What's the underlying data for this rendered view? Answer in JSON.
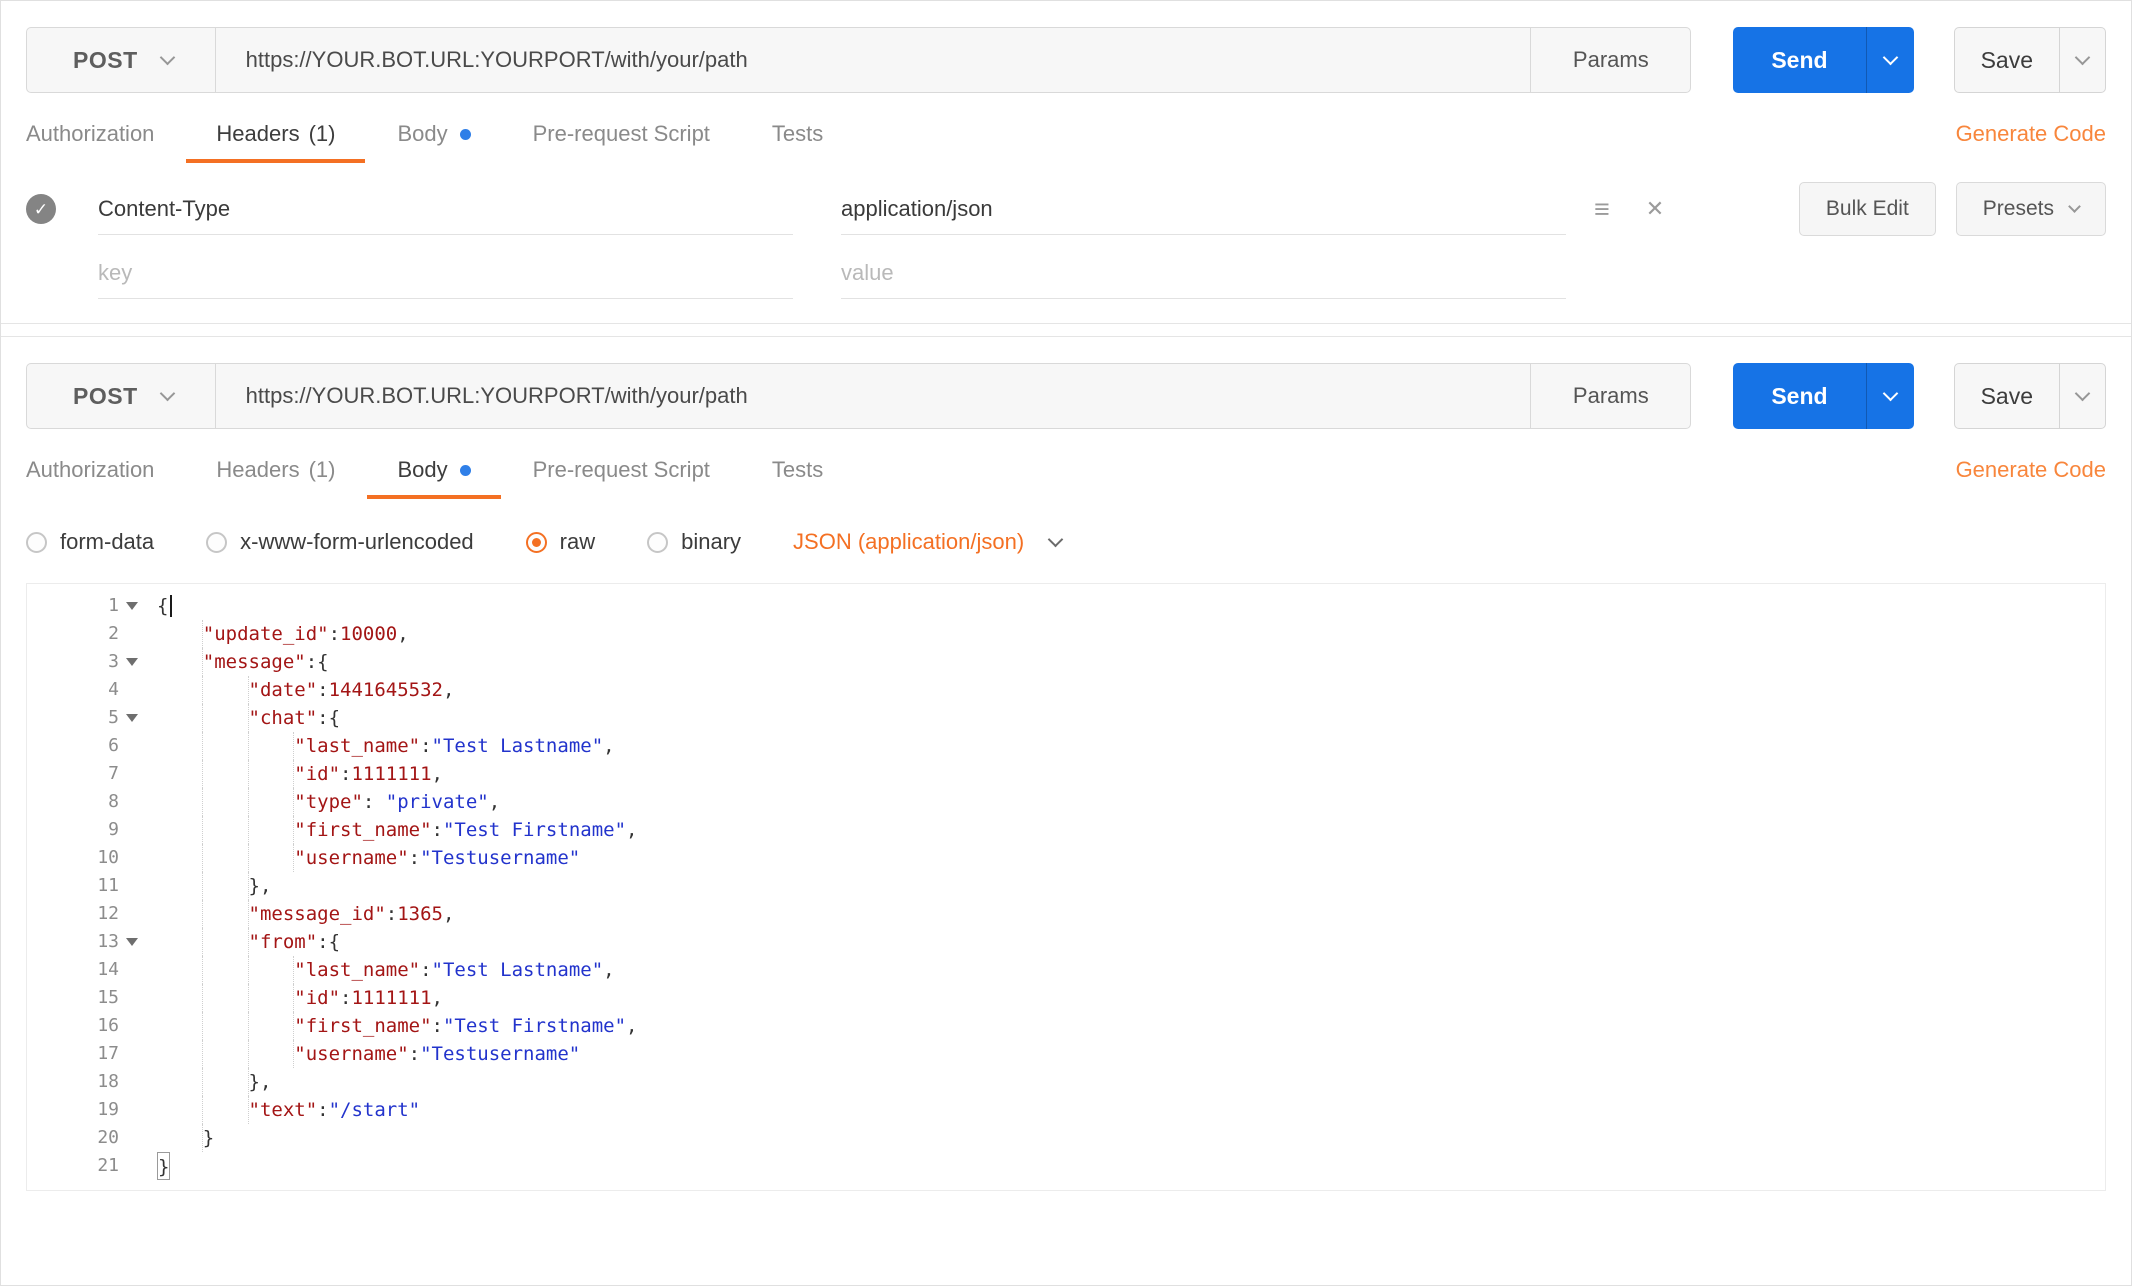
{
  "colors": {
    "accent_orange": "#f47023",
    "generate_code_orange": "#f8863c",
    "send_blue": "#1673e6",
    "body_dot_blue": "#2f7fe8",
    "code_key": "#a31515",
    "code_number": "#a31515",
    "code_string": "#2233cc",
    "code_punct": "#333333"
  },
  "panels": [
    {
      "request": {
        "method": "POST",
        "url": "https://YOUR.BOT.URL:YOURPORT/with/your/path",
        "params_label": "Params",
        "send_label": "Send",
        "save_label": "Save"
      },
      "tabs": [
        {
          "label": "Authorization"
        },
        {
          "label": "Headers",
          "count": "(1)"
        },
        {
          "label": "Body",
          "has_dot": true
        },
        {
          "label": "Pre-request Script"
        },
        {
          "label": "Tests"
        }
      ],
      "active_tab": "Headers",
      "generate_code_label": "Generate Code",
      "headers_editor": {
        "rows": [
          {
            "checked": true,
            "key": "Content-Type",
            "value": "application/json"
          }
        ],
        "key_placeholder": "key",
        "value_placeholder": "value",
        "bulk_edit_label": "Bulk Edit",
        "presets_label": "Presets"
      }
    },
    {
      "request": {
        "method": "POST",
        "url": "https://YOUR.BOT.URL:YOURPORT/with/your/path",
        "params_label": "Params",
        "send_label": "Send",
        "save_label": "Save"
      },
      "tabs": [
        {
          "label": "Authorization"
        },
        {
          "label": "Headers",
          "count": "(1)"
        },
        {
          "label": "Body",
          "has_dot": true
        },
        {
          "label": "Pre-request Script"
        },
        {
          "label": "Tests"
        }
      ],
      "active_tab": "Body",
      "generate_code_label": "Generate Code",
      "body_editor": {
        "modes": [
          "form-data",
          "x-www-form-urlencoded",
          "raw",
          "binary"
        ],
        "selected_mode": "raw",
        "content_type_label": "JSON (application/json)",
        "code_lines": [
          {
            "num": 1,
            "fold": true,
            "indent": 0,
            "tokens": [
              {
                "t": "p",
                "v": "{"
              },
              {
                "t": "cursor"
              }
            ]
          },
          {
            "num": 2,
            "indent": 1,
            "tokens": [
              {
                "t": "k",
                "v": "\"update_id\""
              },
              {
                "t": "p",
                "v": ":"
              },
              {
                "t": "n",
                "v": "10000"
              },
              {
                "t": "p",
                "v": ","
              }
            ]
          },
          {
            "num": 3,
            "fold": true,
            "indent": 1,
            "tokens": [
              {
                "t": "k",
                "v": "\"message\""
              },
              {
                "t": "p",
                "v": ":{"
              }
            ]
          },
          {
            "num": 4,
            "indent": 2,
            "tokens": [
              {
                "t": "k",
                "v": "\"date\""
              },
              {
                "t": "p",
                "v": ":"
              },
              {
                "t": "n",
                "v": "1441645532"
              },
              {
                "t": "p",
                "v": ","
              }
            ]
          },
          {
            "num": 5,
            "fold": true,
            "indent": 2,
            "tokens": [
              {
                "t": "k",
                "v": "\"chat\""
              },
              {
                "t": "p",
                "v": ":{"
              }
            ]
          },
          {
            "num": 6,
            "indent": 3,
            "tokens": [
              {
                "t": "k",
                "v": "\"last_name\""
              },
              {
                "t": "p",
                "v": ":"
              },
              {
                "t": "s",
                "v": "\"Test Lastname\""
              },
              {
                "t": "p",
                "v": ","
              }
            ]
          },
          {
            "num": 7,
            "indent": 3,
            "tokens": [
              {
                "t": "k",
                "v": "\"id\""
              },
              {
                "t": "p",
                "v": ":"
              },
              {
                "t": "n",
                "v": "1111111"
              },
              {
                "t": "p",
                "v": ","
              }
            ]
          },
          {
            "num": 8,
            "indent": 3,
            "tokens": [
              {
                "t": "k",
                "v": "\"type\""
              },
              {
                "t": "p",
                "v": ": "
              },
              {
                "t": "s",
                "v": "\"private\""
              },
              {
                "t": "p",
                "v": ","
              }
            ]
          },
          {
            "num": 9,
            "indent": 3,
            "tokens": [
              {
                "t": "k",
                "v": "\"first_name\""
              },
              {
                "t": "p",
                "v": ":"
              },
              {
                "t": "s",
                "v": "\"Test Firstname\""
              },
              {
                "t": "p",
                "v": ","
              }
            ]
          },
          {
            "num": 10,
            "indent": 3,
            "tokens": [
              {
                "t": "k",
                "v": "\"username\""
              },
              {
                "t": "p",
                "v": ":"
              },
              {
                "t": "s",
                "v": "\"Testusername\""
              }
            ]
          },
          {
            "num": 11,
            "indent": 2,
            "tokens": [
              {
                "t": "p",
                "v": "},"
              }
            ]
          },
          {
            "num": 12,
            "indent": 2,
            "tokens": [
              {
                "t": "k",
                "v": "\"message_id\""
              },
              {
                "t": "p",
                "v": ":"
              },
              {
                "t": "n",
                "v": "1365"
              },
              {
                "t": "p",
                "v": ","
              }
            ]
          },
          {
            "num": 13,
            "fold": true,
            "indent": 2,
            "tokens": [
              {
                "t": "k",
                "v": "\"from\""
              },
              {
                "t": "p",
                "v": ":{"
              }
            ]
          },
          {
            "num": 14,
            "indent": 3,
            "tokens": [
              {
                "t": "k",
                "v": "\"last_name\""
              },
              {
                "t": "p",
                "v": ":"
              },
              {
                "t": "s",
                "v": "\"Test Lastname\""
              },
              {
                "t": "p",
                "v": ","
              }
            ]
          },
          {
            "num": 15,
            "indent": 3,
            "tokens": [
              {
                "t": "k",
                "v": "\"id\""
              },
              {
                "t": "p",
                "v": ":"
              },
              {
                "t": "n",
                "v": "1111111"
              },
              {
                "t": "p",
                "v": ","
              }
            ]
          },
          {
            "num": 16,
            "indent": 3,
            "tokens": [
              {
                "t": "k",
                "v": "\"first_name\""
              },
              {
                "t": "p",
                "v": ":"
              },
              {
                "t": "s",
                "v": "\"Test Firstname\""
              },
              {
                "t": "p",
                "v": ","
              }
            ]
          },
          {
            "num": 17,
            "indent": 3,
            "tokens": [
              {
                "t": "k",
                "v": "\"username\""
              },
              {
                "t": "p",
                "v": ":"
              },
              {
                "t": "s",
                "v": "\"Testusername\""
              }
            ]
          },
          {
            "num": 18,
            "indent": 2,
            "tokens": [
              {
                "t": "p",
                "v": "},"
              }
            ]
          },
          {
            "num": 19,
            "indent": 2,
            "tokens": [
              {
                "t": "k",
                "v": "\"text\""
              },
              {
                "t": "p",
                "v": ":"
              },
              {
                "t": "s",
                "v": "\"/start\""
              }
            ]
          },
          {
            "num": 20,
            "indent": 1,
            "tokens": [
              {
                "t": "p",
                "v": "}"
              }
            ]
          },
          {
            "num": 21,
            "indent": 0,
            "tokens": [
              {
                "t": "pb",
                "v": "}"
              }
            ]
          }
        ]
      }
    }
  ]
}
